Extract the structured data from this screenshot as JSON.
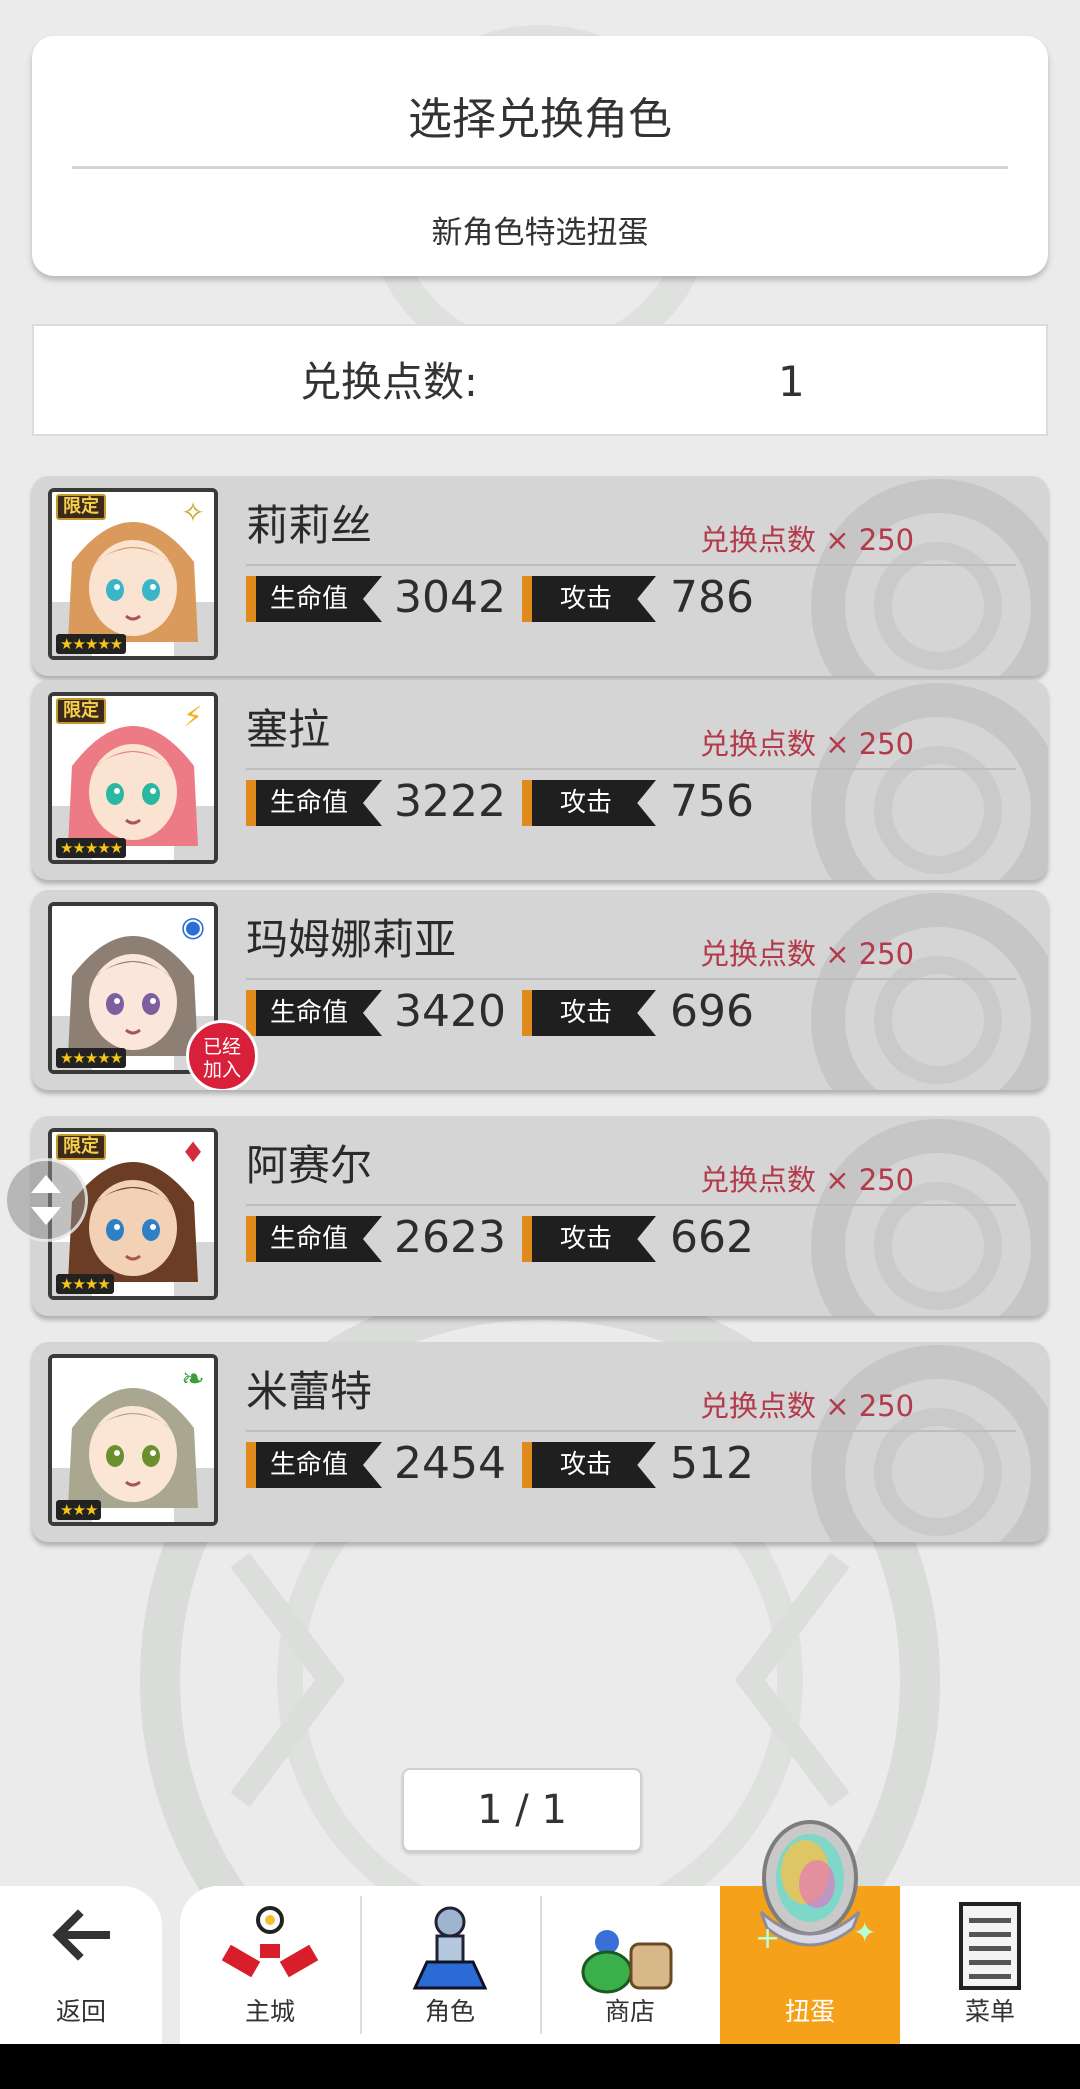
{
  "header": {
    "title": "选择兑换角色",
    "subtitle": "新角色特选扭蛋"
  },
  "points": {
    "label": "兑换点数:",
    "value": "1"
  },
  "stat_labels": {
    "hp": "生命值",
    "atk": "攻击"
  },
  "characters": [
    {
      "name": "莉莉丝",
      "cost": "兑换点数 × 250",
      "hp": "3042",
      "atk": "786",
      "limited": "限定",
      "stars": "★★★★★",
      "element": "✧",
      "element_color": "#c9a227",
      "hair": "#d99a5b",
      "eyes": "#38b6c8",
      "skin": "#fbe3d2"
    },
    {
      "name": "塞拉",
      "cost": "兑换点数 × 250",
      "hp": "3222",
      "atk": "756",
      "limited": "限定",
      "stars": "★★★★★",
      "element": "⚡",
      "element_color": "#f2b01e",
      "hair": "#ec7b86",
      "eyes": "#2bb8a0",
      "skin": "#fbe3d2"
    },
    {
      "name": "玛姆娜莉亚",
      "cost": "兑换点数 × 250",
      "hp": "3420",
      "atk": "696",
      "limited": "",
      "stars": "★★★★★",
      "element": "◉",
      "element_color": "#2b6fd6",
      "hair": "#8e7f74",
      "eyes": "#7d5fa0",
      "skin": "#fbe6dc",
      "joined": "已经\n加入"
    },
    {
      "name": "阿赛尔",
      "cost": "兑换点数 × 250",
      "hp": "2623",
      "atk": "662",
      "limited": "限定",
      "stars": "★★★★",
      "element": "♦",
      "element_color": "#d22d3c",
      "hair": "#6b3d24",
      "eyes": "#2e7fc4",
      "skin": "#f3d1b5"
    },
    {
      "name": "米蕾特",
      "cost": "兑换点数 × 250",
      "hp": "2454",
      "atk": "512",
      "limited": "",
      "stars": "★★★",
      "element": "❧",
      "element_color": "#3a9e3a",
      "hair": "#a9a78f",
      "eyes": "#6a8f2c",
      "skin": "#fbe6d6"
    }
  ],
  "pager": "1 / 1",
  "nav": {
    "back": "返回",
    "items": [
      "主城",
      "角色",
      "商店",
      "扭蛋",
      "菜单"
    ],
    "active_index": 3
  },
  "colors": {
    "accent": "#f5a21a",
    "cost_text": "#b23a4a",
    "stat_bar": "#e08a1e"
  }
}
